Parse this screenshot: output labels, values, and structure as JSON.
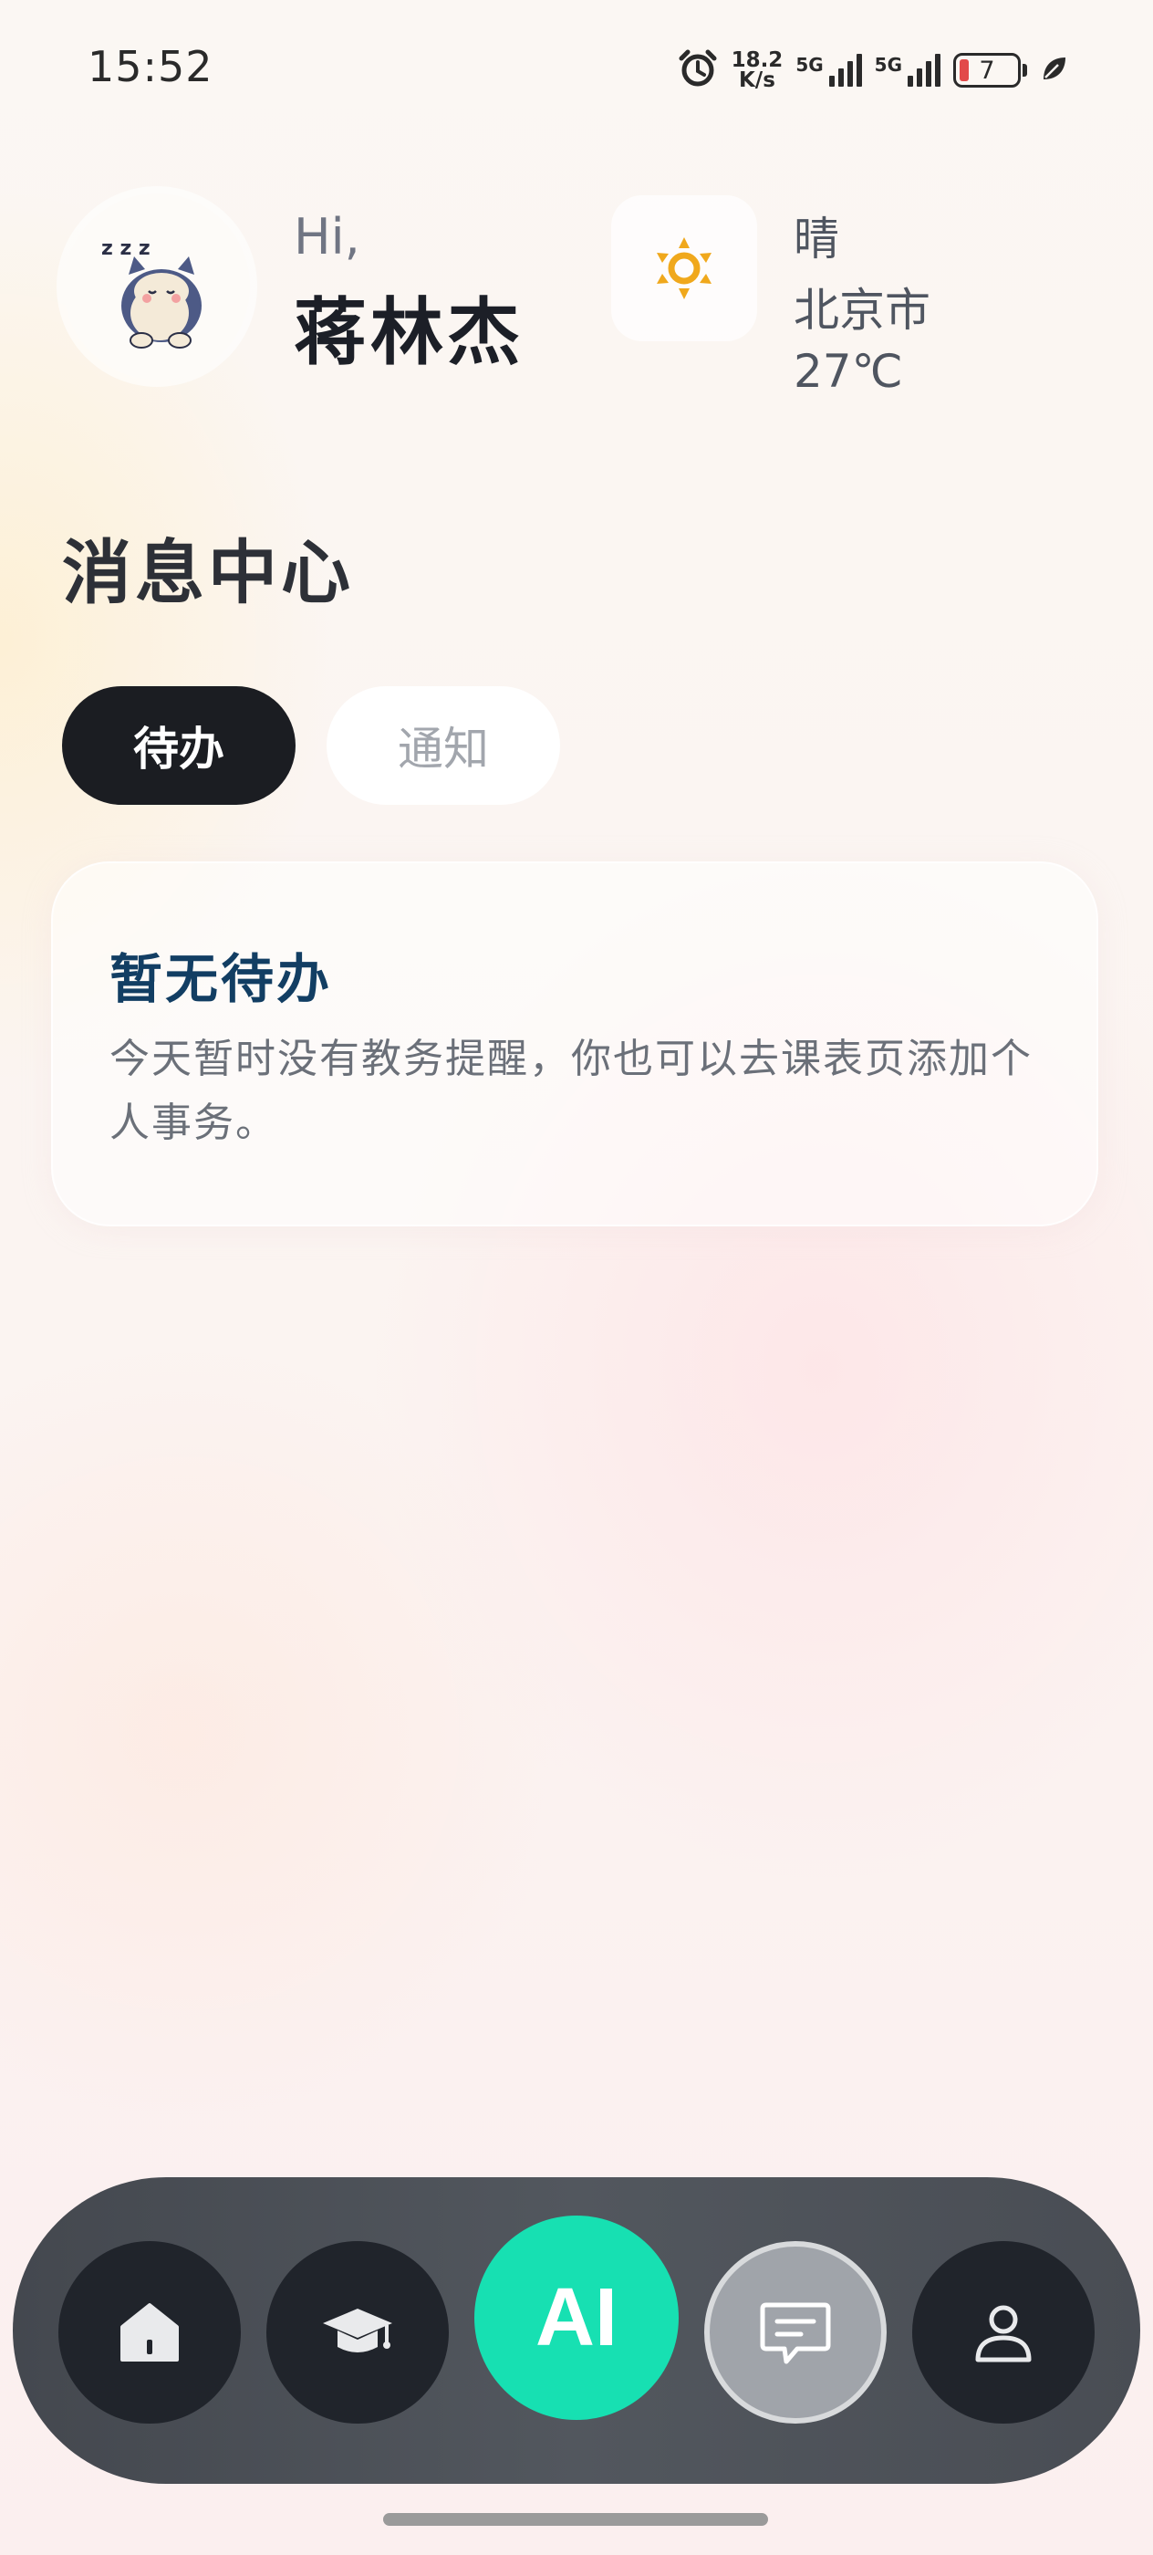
{
  "status_bar": {
    "time": "15:52",
    "net_speed_value": "18.2",
    "net_speed_unit": "K/s",
    "signal1_label": "5G",
    "signal2_label": "5G",
    "battery_level": "7",
    "icons": [
      "alarm-icon",
      "signal-icon",
      "battery-icon",
      "leaf-icon"
    ]
  },
  "header": {
    "greeting": "Hi,",
    "user_name": "蒋林杰",
    "weather": {
      "condition": "晴",
      "city": "北京市",
      "temperature": "27℃",
      "icon": "sun-icon",
      "icon_color": "#f0a81c"
    }
  },
  "message_center": {
    "title": "消息中心",
    "tabs": [
      {
        "label": "待办",
        "active": true
      },
      {
        "label": "通知",
        "active": false
      }
    ],
    "empty_card": {
      "title": "暂无待办",
      "body": "今天暂时没有教务提醒，你也可以去课表页添加个人事务。"
    }
  },
  "bottom_nav": {
    "items": [
      {
        "name": "home",
        "icon": "home-icon"
      },
      {
        "name": "courses",
        "icon": "graduation-cap-icon"
      },
      {
        "name": "ai",
        "label": "AI"
      },
      {
        "name": "messages",
        "icon": "chat-icon",
        "active": true
      },
      {
        "name": "profile",
        "icon": "person-icon"
      }
    ],
    "ai_color": "#17e0b2"
  }
}
